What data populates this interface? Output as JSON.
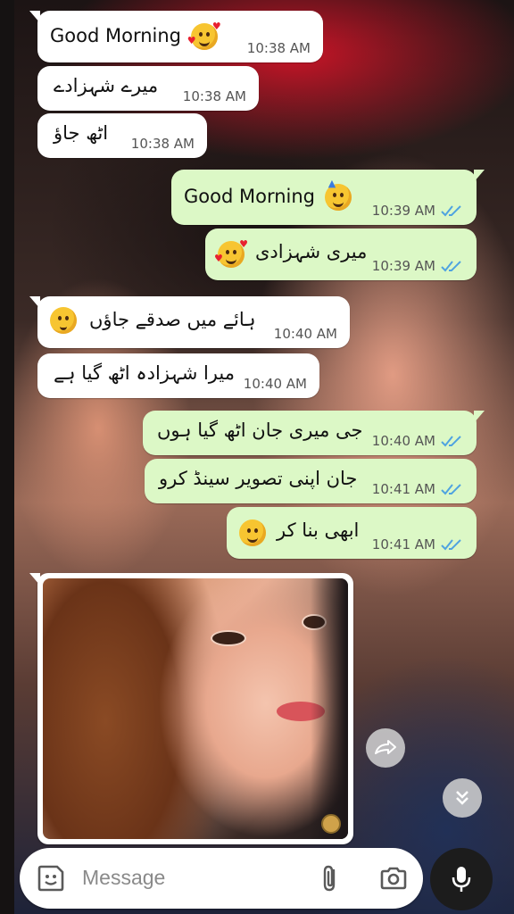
{
  "messages": [
    {
      "dir": "in",
      "text": "Good Morning",
      "emoji": "smiling-face-with-hearts",
      "time": "10:38 AM"
    },
    {
      "dir": "in",
      "text": "میرے شہزادے",
      "time": "10:38 AM"
    },
    {
      "dir": "in",
      "text": "اٹھ جاؤ",
      "time": "10:38 AM"
    },
    {
      "dir": "out",
      "text": "Good Morning",
      "emoji": "partying-face",
      "time": "10:39 AM",
      "status": "read"
    },
    {
      "dir": "out",
      "text": "میری شہزادی",
      "emoji": "smiling-face-with-hearts",
      "time": "10:39 AM",
      "status": "read"
    },
    {
      "dir": "in",
      "text": "ہائے میں صدقے جاؤں",
      "emoji": "face-with-monocle-shy",
      "time": "10:40 AM"
    },
    {
      "dir": "in",
      "text": "میرا شہزادہ اٹھ گیا ہے",
      "time": "10:40 AM"
    },
    {
      "dir": "out",
      "text": "جی میری جان اٹھ گیا ہوں",
      "time": "10:40 AM",
      "status": "read"
    },
    {
      "dir": "out",
      "text": "جان اپنی تصویر سینڈ کرو",
      "time": "10:41 AM",
      "status": "read"
    },
    {
      "dir": "out",
      "text": "ابھی بنا کر",
      "emoji": "hugging-face",
      "time": "10:41 AM",
      "status": "read"
    }
  ],
  "image_message": {
    "dir": "in",
    "content": "photo"
  },
  "composer": {
    "placeholder": "Message"
  },
  "icons": {
    "sticker": "sticker-icon",
    "attach": "paperclip-icon",
    "camera": "camera-icon",
    "mic": "microphone-icon",
    "forward": "forward-icon",
    "scroll_down": "double-chevron-down-icon",
    "read_ticks": "double-check-icon"
  },
  "colors": {
    "incoming_bubble": "#ffffff",
    "outgoing_bubble": "#dcf8c6",
    "read_tick": "#4fa3e0",
    "mic_button": "#1c1c1c"
  }
}
